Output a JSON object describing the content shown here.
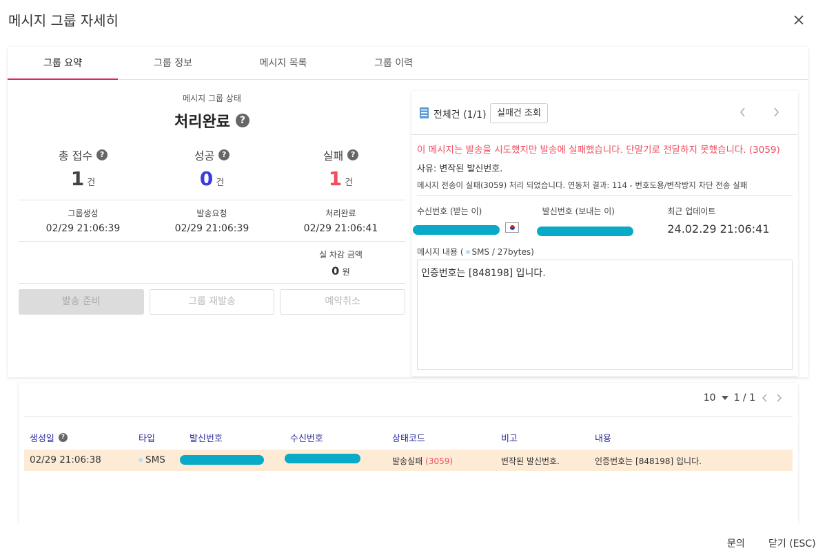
{
  "dialog": {
    "title": "메시지 그룹 자세히"
  },
  "tabs": [
    "그룹 요약",
    "그룹 정보",
    "메시지 목록",
    "그룹 이력"
  ],
  "summary": {
    "status_label": "메시지 그룹 상태",
    "status_value": "처리완료",
    "counts": [
      {
        "label": "총 접수",
        "value": "1",
        "unit": "건"
      },
      {
        "label": "성공",
        "value": "0",
        "unit": "건"
      },
      {
        "label": "실패",
        "value": "1",
        "unit": "건"
      }
    ],
    "times": [
      {
        "label": "그룹생성",
        "value": "02/29 21:06:39"
      },
      {
        "label": "발송요청",
        "value": "02/29 21:06:39"
      },
      {
        "label": "처리완료",
        "value": "02/29 21:06:41"
      }
    ],
    "amount_label": "실 차감 금액",
    "amount_value": "0",
    "amount_unit": "원",
    "buttons": [
      "발송 준비",
      "그룹 재발송",
      "예약취소"
    ]
  },
  "detail": {
    "total": "전체건 (1/1)",
    "failed_query_button": "실패건 조회",
    "error_message": "이 메시지는 발송을 시도했지만 발송에 실패했습니다. 단말기로 전달하지 못했습니다. (3059)",
    "reason": "사유: 변작된 발신번호.",
    "detail_text": "메시지 전송이 실패(3059) 처리 되었습니다. 연동처 결과: 114 - 번호도용/변작방지 차단 전송 실패",
    "to_label": "수신번호 (받는 이)",
    "from_label": "발신번호 (보내는 이)",
    "updated_label": "최근 업데이트",
    "updated_value": "24.02.29 21:06:41",
    "content_label_prefix": "메시지 내용 (",
    "content_label_suffix": "SMS / 27bytes)",
    "content": "인증번호는 [848198] 입니다."
  },
  "messages": {
    "page_size": "10",
    "page_info": "1 / 1",
    "columns": [
      "생성일",
      "타입",
      "발신번호",
      "수신번호",
      "상태코드",
      "비고",
      "내용"
    ],
    "rows": [
      {
        "created": "02/29 21:06:38",
        "type": "SMS",
        "status": "발송실패",
        "status_code": "(3059)",
        "note": "변작된 발신번호.",
        "content": "인증번호는 [848198] 입니다."
      }
    ]
  },
  "footer": {
    "inquiry": "문의",
    "close": "닫기 (ESC)"
  },
  "colors": {
    "accent": "#e0245e",
    "success": "#3b3bdf",
    "fail": "#f04d5e",
    "redaction": "#08aac7",
    "row_highlight": "#fdebd6"
  }
}
